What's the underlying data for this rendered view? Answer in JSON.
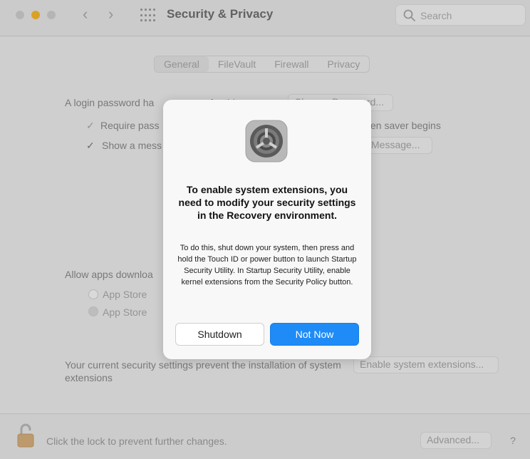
{
  "window": {
    "title": "Security & Privacy",
    "search_placeholder": "Search",
    "nav": {
      "back": "‹",
      "forward": "›"
    }
  },
  "tabs": [
    "General",
    "FileVault",
    "Firewall",
    "Privacy"
  ],
  "general": {
    "login_password_text": "A login password ha",
    "login_password_text_2": "for this u",
    "change_password_label": "Change Password...",
    "require_password_label": "Require pass",
    "screen_saver_tail": "en saver begins",
    "show_message_label": "Show a mess",
    "set_message_label": "Message...",
    "allow_apps_label": "Allow apps downloa",
    "app_store_label": "App Store",
    "app_store_identified_label": "App Store",
    "security_warning": "Your current security settings prevent the installation of system extensions",
    "enable_extensions_label": "Enable system extensions..."
  },
  "bottom": {
    "lock_text": "Click the lock to prevent further changes.",
    "advanced_label": "Advanced...",
    "help_label": "?"
  },
  "dialog": {
    "icon": "system-preferences-icon",
    "headline": "To enable system extensions, you need to modify your security settings in the Recovery environment.",
    "body": "To do this, shut down your system, then press and hold the Touch ID or power button to launch Startup Security Utility. In Startup Security Utility, enable kernel extensions from the Security Policy button.",
    "shutdown_label": "Shutdown",
    "not_now_label": "Not Now"
  },
  "colors": {
    "accent": "#1f8bf6",
    "traffic_yellow": "#f7b92d"
  }
}
